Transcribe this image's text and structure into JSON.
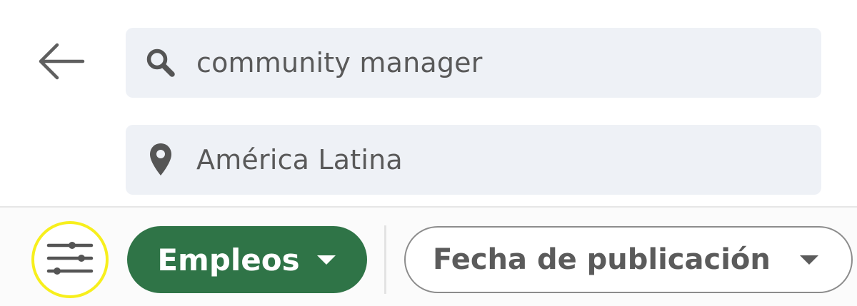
{
  "header": {
    "back_icon": "arrow-left-icon"
  },
  "search": {
    "query": "community manager",
    "icon": "search-icon"
  },
  "location": {
    "value": "América Latina",
    "icon": "location-pin-icon"
  },
  "filters": {
    "filter_icon": "sliders-icon",
    "highlight_color": "#f7ef1c",
    "jobs_pill": {
      "label": "Empleos",
      "icon": "caret-down-icon",
      "color": "#2f7447"
    },
    "date_pill": {
      "label": "Fecha de publicación",
      "icon": "caret-down-icon"
    }
  }
}
